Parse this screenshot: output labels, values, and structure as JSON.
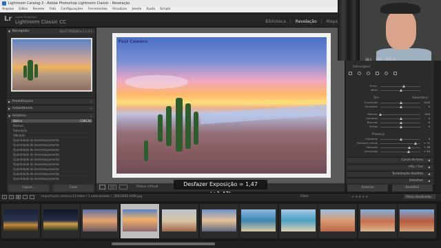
{
  "window": {
    "title": "Lightroom Catalog-3 - Adobe Photoshop Lightroom Classic - Revelação"
  },
  "menu": [
    "Arquivo",
    "Editar",
    "Revelar",
    "Foto",
    "Configurações",
    "Ferramentas",
    "Visualizar",
    "Janela",
    "Ajuda",
    "Scripts"
  ],
  "identity": {
    "logo": "Lr",
    "adobe": "Adobe Photoshop",
    "name": "Lightroom Classic CC"
  },
  "modules": [
    "Biblioteca",
    "Revelação",
    "Mapa"
  ],
  "left_panel": {
    "navigator": {
      "title": "Navegador",
      "options": "AJUST  PREENCH  1:1  3:1"
    },
    "presets_title": "Predefinições",
    "snapshots_title": "Instantâneos",
    "history_title": "Histórico",
    "history": [
      {
        "label": "Básico",
        "v1": "-136",
        "v2": "+136",
        "selected": true
      },
      {
        "label": "Realces",
        "v1": "",
        "v2": "",
        "selected": false
      },
      {
        "label": "Saturação",
        "v1": "",
        "v2": "",
        "selected": false
      },
      {
        "label": "Vibração",
        "v1": "",
        "v2": "",
        "selected": false
      },
      {
        "label": "Quantidade de desembaçamento",
        "v1": "",
        "v2": "",
        "selected": false
      },
      {
        "label": "Quantidade de desembaçamento",
        "v1": "",
        "v2": "",
        "selected": false
      },
      {
        "label": "Quantidade de desembaçamento",
        "v1": "",
        "v2": "",
        "selected": false
      },
      {
        "label": "Quantidade de desembaçamento",
        "v1": "",
        "v2": "",
        "selected": false
      },
      {
        "label": "Quantidade de desembaçamento",
        "v1": "",
        "v2": "",
        "selected": false
      },
      {
        "label": "Quantidade de desembaçamento",
        "v1": "",
        "v2": "",
        "selected": false
      },
      {
        "label": "Quantidade de desembaçamento",
        "v1": "",
        "v2": "",
        "selected": false
      },
      {
        "label": "Quantidade de desembaçamento",
        "v1": "",
        "v2": "",
        "selected": false
      },
      {
        "label": "Quantidade de desembaçamento",
        "v1": "",
        "v2": "",
        "selected": false
      }
    ],
    "copy_button": "Copiar...",
    "paste_button": "Colar"
  },
  "photo": {
    "watermark": "Fast Camera"
  },
  "toolbar": {
    "proof_label": "Prova virtual",
    "view_compare": "Y|Y"
  },
  "toast": "Desfazer Exposição = 1,47 (+1,47)",
  "right_panel": {
    "hist_values": [
      "38,2",
      "30,5",
      "25,1 %"
    ],
    "original_label": "Foto original",
    "basic": {
      "temp": {
        "label": "Temp.",
        "value": ""
      },
      "tint": {
        "label": "Matiz",
        "value": ""
      },
      "tone_title": "Tom",
      "auto": "Automático",
      "exposure": {
        "label": "Exposição",
        "value": "0,00"
      },
      "contrast": {
        "label": "Contraste",
        "value": "0"
      },
      "highlights": {
        "label": "Realces",
        "value": "-100"
      },
      "shadows": {
        "label": "Sombras",
        "value": "0"
      },
      "whites": {
        "label": "Brancos",
        "value": "0"
      },
      "blacks": {
        "label": "Pretos",
        "value": "0"
      },
      "presence_title": "Presença",
      "clarity": {
        "label": "Claridade",
        "value": "0"
      },
      "dehaze": {
        "label": "Remover névoa",
        "value": "+ 71"
      },
      "vibrance": {
        "label": "Vibração",
        "value": "+ 38"
      },
      "saturation": {
        "label": "Saturação",
        "value": "+ 34"
      }
    },
    "sections": [
      "Curva de tons",
      "HSL / Cor",
      "Tonalização dividida",
      "Detalhes"
    ],
    "prev_button": "Anterior",
    "reset_button": "Redefinir"
  },
  "filmstrip": {
    "import_label": "Importação anterior",
    "path_label": "13 fotos / 1 selecionado / _DSC0262-HDR.jpg",
    "filter_label": "Filtro:",
    "stars": "★★★★★",
    "filter_value": "Filtros desativados"
  },
  "colors": {
    "panel": "#2b2b2b",
    "background": "#1e1e1e",
    "accent_text": "#e0e0e0"
  }
}
